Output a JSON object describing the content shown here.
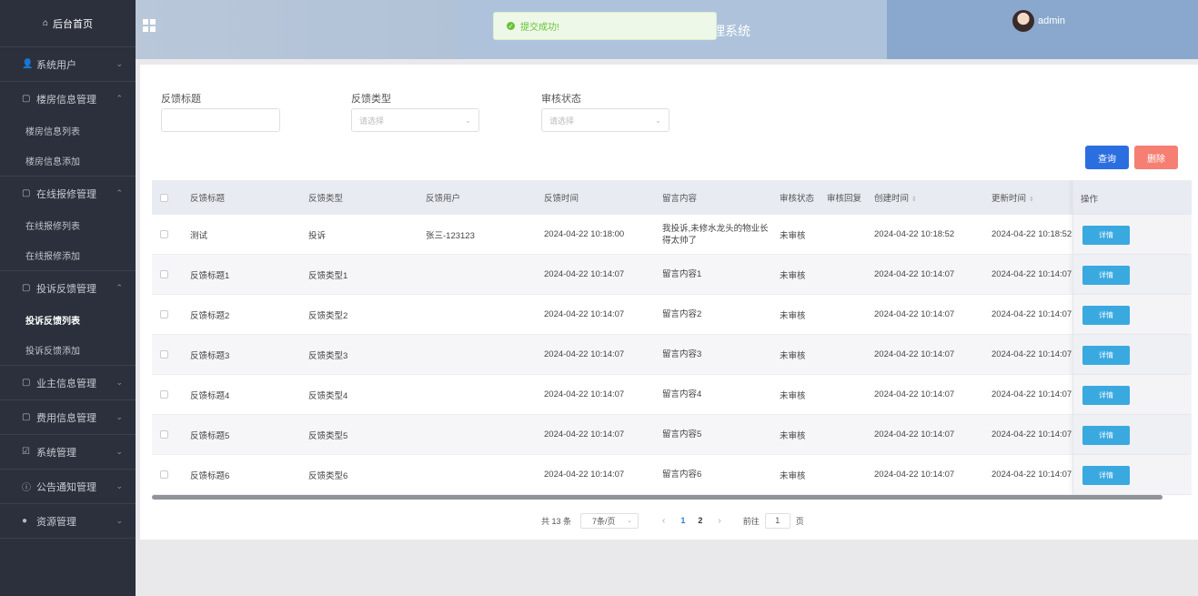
{
  "sidebar": {
    "home": "后台首页",
    "groups": [
      {
        "label": "系统用户",
        "chev": "⌄",
        "subs": []
      },
      {
        "label": "楼房信息管理",
        "chev": "⌃",
        "subs": [
          "楼房信息列表",
          "楼房信息添加"
        ]
      },
      {
        "label": "在线报修管理",
        "chev": "⌃",
        "subs": [
          "在线报修列表",
          "在线报修添加"
        ]
      },
      {
        "label": "投诉反馈管理",
        "chev": "⌃",
        "subs": [
          "投诉反馈列表",
          "投诉反馈添加"
        ]
      },
      {
        "label": "业主信息管理",
        "chev": "⌄",
        "subs": []
      },
      {
        "label": "费用信息管理",
        "chev": "⌄",
        "subs": []
      },
      {
        "label": "系统管理",
        "chev": "⌄",
        "subs": []
      },
      {
        "label": "公告通知管理",
        "chev": "⌄",
        "subs": []
      },
      {
        "label": "资源管理",
        "chev": "⌄",
        "subs": []
      }
    ]
  },
  "header": {
    "title": "理系统",
    "user": "admin"
  },
  "toast": {
    "message": "提交成功!"
  },
  "filters": {
    "title_label": "反馈标题",
    "title_value": "",
    "type_label": "反馈类型",
    "type_placeholder": "请选择",
    "status_label": "审核状态",
    "status_placeholder": "请选择"
  },
  "buttons": {
    "query": "查询",
    "delete": "删除"
  },
  "table": {
    "headers": {
      "title": "反馈标题",
      "type": "反馈类型",
      "user": "反馈用户",
      "time": "反馈时间",
      "content": "留言内容",
      "status": "审核状态",
      "reply": "审核回复",
      "created": "创建时间",
      "updated": "更新时间",
      "op": "操作"
    },
    "sort_icon": "⇕",
    "detail_label": "详情",
    "rows": [
      {
        "title": "测试",
        "type": "投诉",
        "user": "张三-123123",
        "time": "2024-04-22 10:18:00",
        "content": "我投诉,未修水龙头的物业长得太帅了",
        "status": "未审核",
        "reply": "",
        "created": "2024-04-22 10:18:52",
        "updated": "2024-04-22 10:18:52"
      },
      {
        "title": "反馈标题1",
        "type": "反馈类型1",
        "user": "",
        "time": "2024-04-22 10:14:07",
        "content": "留言内容1",
        "status": "未审核",
        "reply": "",
        "created": "2024-04-22 10:14:07",
        "updated": "2024-04-22 10:14:07"
      },
      {
        "title": "反馈标题2",
        "type": "反馈类型2",
        "user": "",
        "time": "2024-04-22 10:14:07",
        "content": "留言内容2",
        "status": "未审核",
        "reply": "",
        "created": "2024-04-22 10:14:07",
        "updated": "2024-04-22 10:14:07"
      },
      {
        "title": "反馈标题3",
        "type": "反馈类型3",
        "user": "",
        "time": "2024-04-22 10:14:07",
        "content": "留言内容3",
        "status": "未审核",
        "reply": "",
        "created": "2024-04-22 10:14:07",
        "updated": "2024-04-22 10:14:07"
      },
      {
        "title": "反馈标题4",
        "type": "反馈类型4",
        "user": "",
        "time": "2024-04-22 10:14:07",
        "content": "留言内容4",
        "status": "未审核",
        "reply": "",
        "created": "2024-04-22 10:14:07",
        "updated": "2024-04-22 10:14:07"
      },
      {
        "title": "反馈标题5",
        "type": "反馈类型5",
        "user": "",
        "time": "2024-04-22 10:14:07",
        "content": "留言内容5",
        "status": "未审核",
        "reply": "",
        "created": "2024-04-22 10:14:07",
        "updated": "2024-04-22 10:14:07"
      },
      {
        "title": "反馈标题6",
        "type": "反馈类型6",
        "user": "",
        "time": "2024-04-22 10:14:07",
        "content": "留言内容6",
        "status": "未审核",
        "reply": "",
        "created": "2024-04-22 10:14:07",
        "updated": "2024-04-22 10:14:07"
      }
    ]
  },
  "pagination": {
    "total": "共 13 条",
    "page_size": "7条/页",
    "pages": [
      "1",
      "2"
    ],
    "current": "1",
    "goto_prefix": "前往",
    "goto_value": "1",
    "goto_suffix": "页"
  }
}
